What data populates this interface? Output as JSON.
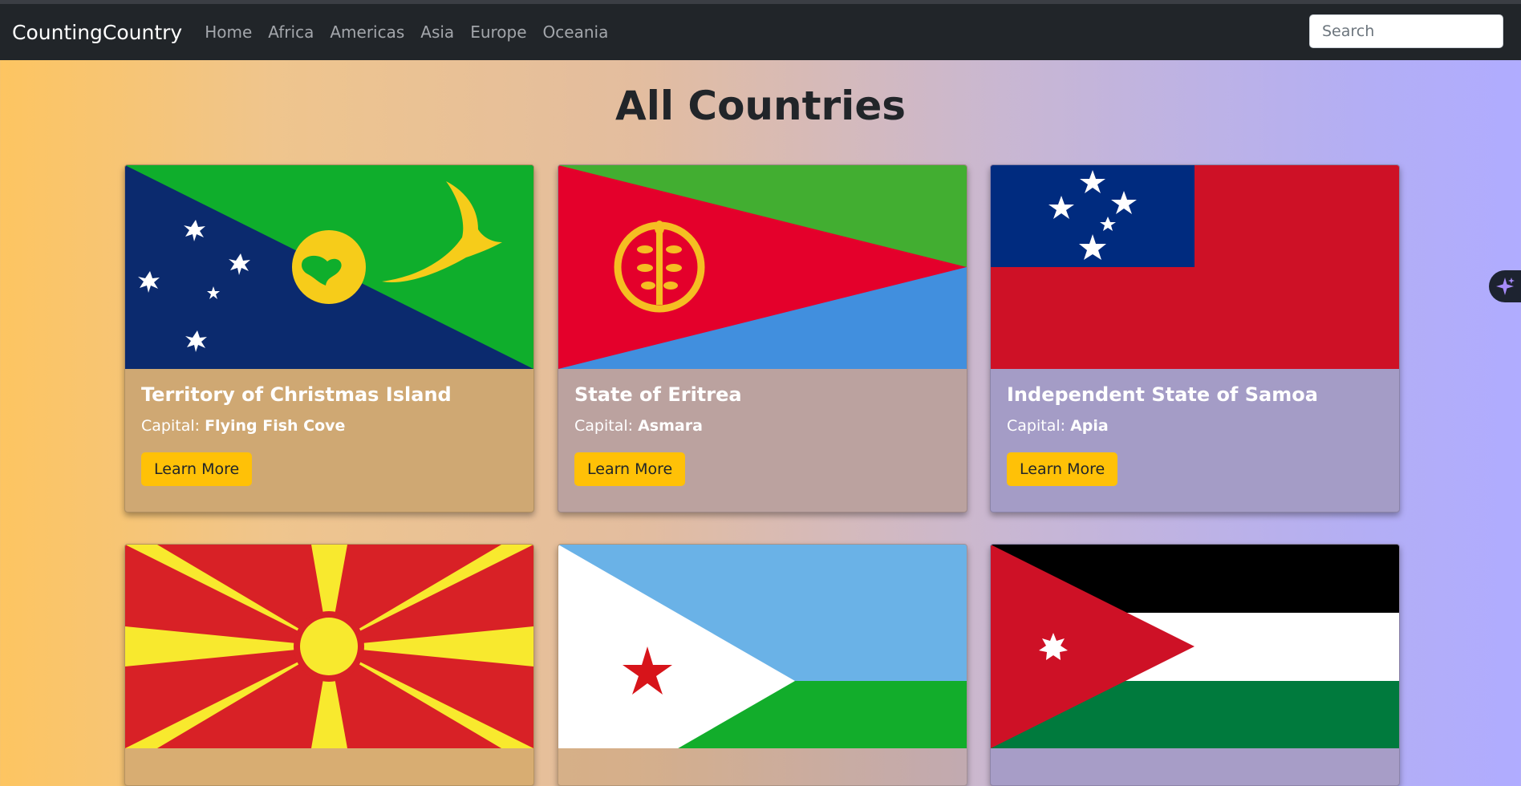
{
  "nav": {
    "brand": "CountingCountry",
    "links": [
      "Home",
      "Africa",
      "Americas",
      "Asia",
      "Europe",
      "Oceania"
    ],
    "search_placeholder": "Search"
  },
  "main": {
    "title": "All Countries",
    "capital_label": "Capital:",
    "button_label": "Learn More",
    "countries": [
      {
        "name": "Territory of Christmas Island",
        "capital": "Flying Fish Cove",
        "flag": "christmas-island-flag"
      },
      {
        "name": "State of Eritrea",
        "capital": "Asmara",
        "flag": "eritrea-flag"
      },
      {
        "name": "Independent State of Samoa",
        "capital": "Apia",
        "flag": "samoa-flag"
      },
      {
        "flag": "north-macedonia-flag"
      },
      {
        "flag": "djibouti-flag"
      },
      {
        "flag": "jordan-flag"
      }
    ]
  },
  "colors": {
    "navbar": "#212529",
    "button": "#ffc107",
    "accent_icon": "#a78bfa"
  },
  "fab": {
    "icon": "sparkles-icon"
  }
}
